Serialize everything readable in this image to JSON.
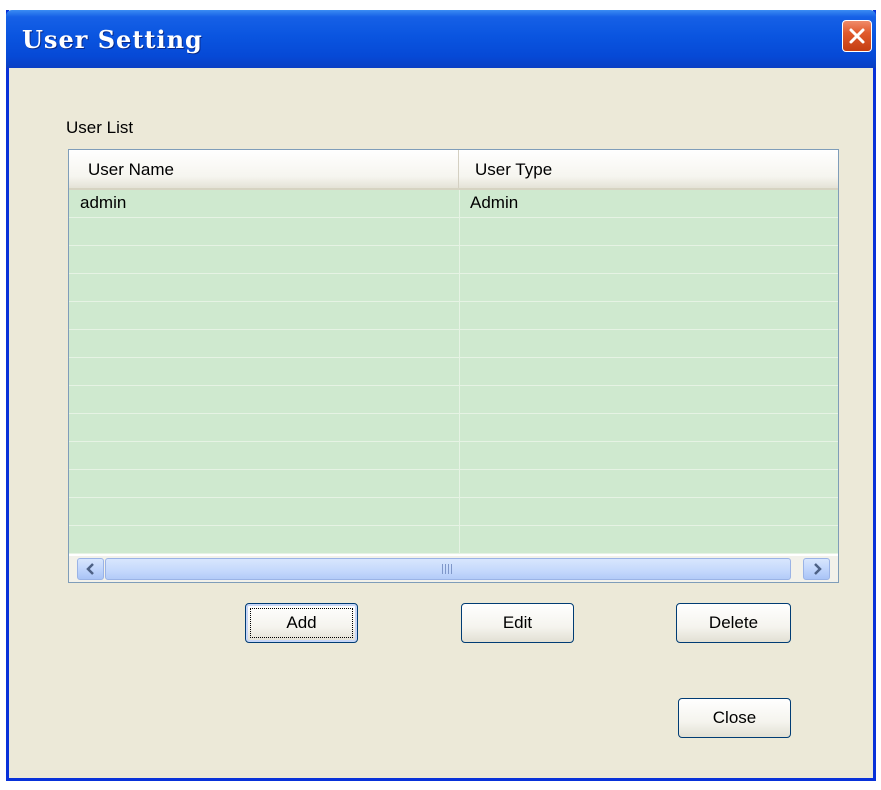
{
  "window": {
    "title": "User Setting"
  },
  "user_list": {
    "label": "User List",
    "columns": [
      "User Name",
      "User Type"
    ],
    "rows": [
      {
        "user_name": "admin",
        "user_type": "Admin"
      }
    ]
  },
  "buttons": {
    "add": "Add",
    "edit": "Edit",
    "delete": "Delete",
    "close": "Close"
  },
  "icons": {
    "close": "close-x-icon",
    "scroll_left": "arrow-left-icon",
    "scroll_right": "arrow-right-icon"
  },
  "colors": {
    "titlebar": "#0a55e0",
    "window_bg": "#ece9d8",
    "list_rows": "#cfe9cf",
    "close_button": "#e05a2c"
  }
}
